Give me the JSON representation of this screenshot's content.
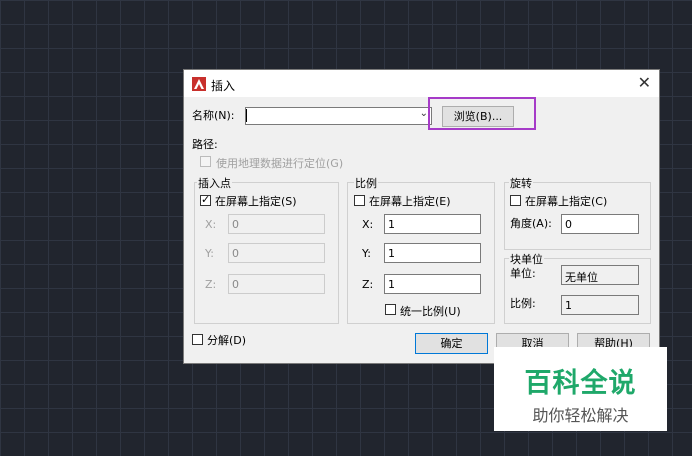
{
  "dialog": {
    "title": "插入",
    "close_glyph": "✕",
    "name_label": "名称(N):",
    "name_value": "",
    "name_arrow": "⌄",
    "browse_button": "浏览(B)...",
    "path_label": "路径:",
    "geo_label": "使用地理数据进行定位(G)",
    "insertion": {
      "group_label": "插入点",
      "on_screen_label": "在屏幕上指定(S)",
      "on_screen_checked": true,
      "x_label": "X:",
      "x_value": "0",
      "y_label": "Y:",
      "y_value": "0",
      "z_label": "Z:",
      "z_value": "0"
    },
    "scale": {
      "group_label": "比例",
      "on_screen_label": "在屏幕上指定(E)",
      "on_screen_checked": false,
      "x_label": "X:",
      "x_value": "1",
      "y_label": "Y:",
      "y_value": "1",
      "z_label": "Z:",
      "z_value": "1",
      "uniform_label": "统一比例(U)"
    },
    "rotation": {
      "group_label": "旋转",
      "on_screen_label": "在屏幕上指定(C)",
      "angle_label": "角度(A):",
      "angle_value": "0"
    },
    "block_unit": {
      "group_label": "块单位",
      "unit_label": "单位:",
      "unit_value": "无单位",
      "factor_label": "比例:",
      "factor_value": "1"
    },
    "explode_label": "分解(D)",
    "ok_button": "确定",
    "cancel_button": "取消",
    "help_button": "帮助(H)"
  },
  "watermark": {
    "line1": "百科全说",
    "line2": "助你轻松解决"
  },
  "colors": {
    "background": "#21252e",
    "highlight": "#a63bc8",
    "watermark": "#1fa86a",
    "app_icon": "#c8302c"
  },
  "icons": {
    "app": "autocad-app-icon",
    "close": "close-icon",
    "dropdown": "chevron-down-icon",
    "check": "checkmark-icon"
  }
}
